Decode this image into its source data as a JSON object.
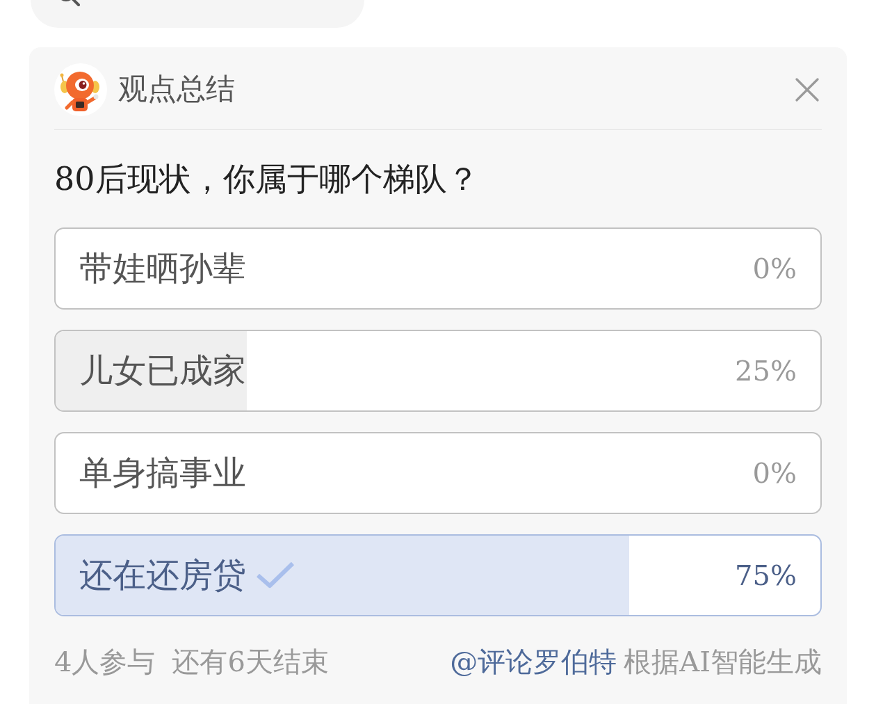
{
  "panel": {
    "title": "观点总结"
  },
  "poll": {
    "question": "80后现状，你属于哪个梯队？",
    "options": [
      {
        "label": "带娃晒孙辈",
        "percent": "0%",
        "selected": false
      },
      {
        "label": "儿女已成家",
        "percent": "25%",
        "level": 0.25,
        "selected": false
      },
      {
        "label": "单身搞事业",
        "percent": "0%",
        "selected": false
      },
      {
        "label": "还在还房贷",
        "percent": "75%",
        "level": 0.75,
        "selected": true
      }
    ]
  },
  "footer": {
    "participants": "4人参与",
    "time_left": "还有6天结束",
    "author": "@评论罗伯特",
    "note": "根据AI智能生成"
  }
}
